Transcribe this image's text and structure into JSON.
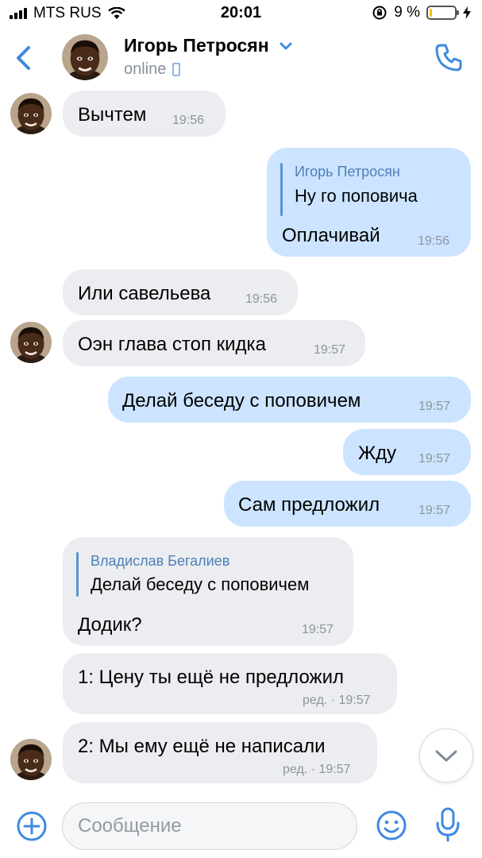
{
  "status_bar": {
    "carrier": "MTS RUS",
    "time": "20:01",
    "battery_percent": "9 %",
    "battery_level": 0.09,
    "icons": [
      "signal-bars-icon",
      "wifi-icon",
      "orientation-lock-icon",
      "battery-icon",
      "charging-icon"
    ]
  },
  "header": {
    "name": "Игорь Петросян",
    "status": "online",
    "icons": [
      "back-arrow-icon",
      "chevron-down-icon",
      "mobile-icon",
      "phone-icon"
    ]
  },
  "messages": [
    {
      "dir": "in",
      "text": "Вычтем",
      "time": "19:56"
    },
    {
      "dir": "out",
      "reply_author": "Игорь Петросян",
      "reply_text": "Ну го поповича",
      "text": "Оплачивай",
      "time": "19:56"
    },
    {
      "dir": "in",
      "text": "Или савельева",
      "time": "19:56"
    },
    {
      "dir": "in",
      "text": "Оэн глава стоп кидка",
      "time": "19:57"
    },
    {
      "dir": "out",
      "text": "Делай беседу с поповичем",
      "time": "19:57"
    },
    {
      "dir": "out",
      "text": "Жду",
      "time": "19:57"
    },
    {
      "dir": "out",
      "text": "Сам предложил",
      "time": "19:57"
    },
    {
      "dir": "in",
      "reply_author": "Владислав Бегалиев",
      "reply_text": "Делай беседу с поповичем",
      "text": "Додик?",
      "time": "19:57"
    },
    {
      "dir": "in",
      "text": "1: Цену ты ещё не предложил",
      "time": "ред. · 19:57"
    },
    {
      "dir": "in",
      "text": "2: Мы ему ещё не написали",
      "time": "ред. · 19:57"
    }
  ],
  "composer": {
    "placeholder": "Сообщение",
    "value": "",
    "icons": [
      "plus-circle-icon",
      "emoji-icon",
      "microphone-icon",
      "chevron-down-icon"
    ]
  },
  "colors": {
    "accent": "#3f8ae0",
    "incoming_bubble": "#ebedf0",
    "outgoing_bubble": "#cce4ff",
    "reply_author": "#4f7fb8",
    "battery_fill": "#f5c400"
  }
}
